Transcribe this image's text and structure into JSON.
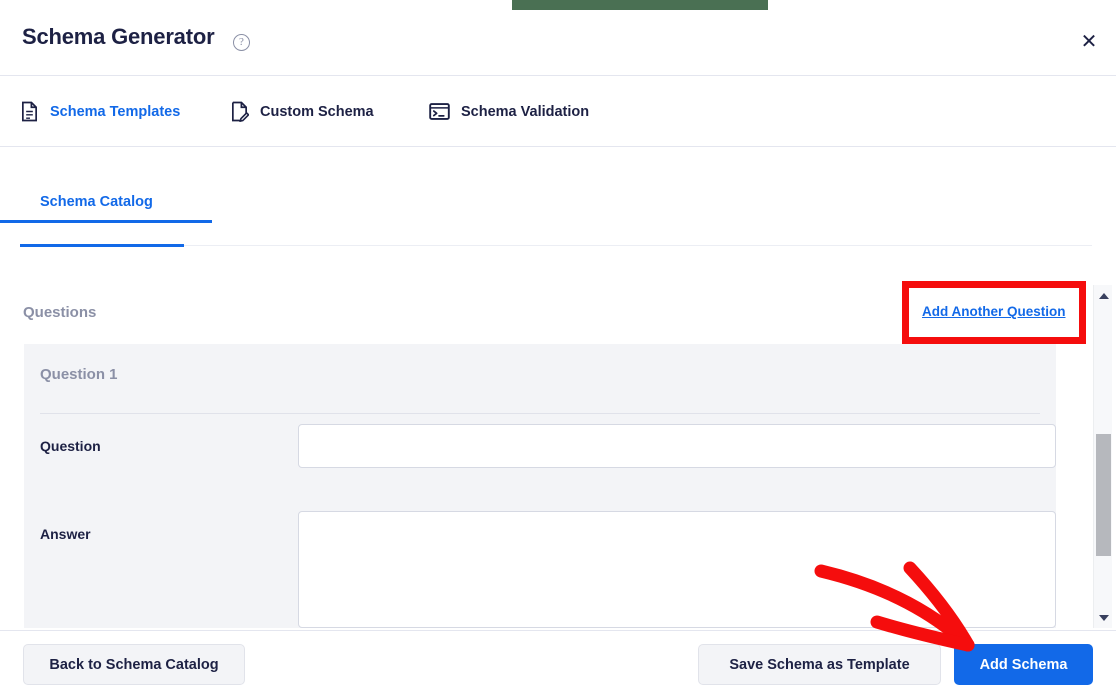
{
  "window": {
    "title": "Schema Generator",
    "help_icon": "question-circle-icon",
    "close_icon": "✕",
    "accent_color": "#1269e8",
    "annotation_color": "#f50d0d",
    "green_strip_color": "#4a7053"
  },
  "tabs": [
    {
      "label": "Schema Templates",
      "icon": "document-lines-icon",
      "active": true
    },
    {
      "label": "Custom Schema",
      "icon": "document-pencil-icon",
      "active": false
    },
    {
      "label": "Schema Validation",
      "icon": "terminal-icon",
      "active": false
    }
  ],
  "subtabs": [
    {
      "label": "Schema Catalog",
      "active": true
    }
  ],
  "content": {
    "section_label": "Questions",
    "add_link": "Add Another Question",
    "question_card": {
      "title": "Question 1",
      "fields": [
        {
          "label": "Question",
          "value": "",
          "placeholder": "",
          "type": "input"
        },
        {
          "label": "Answer",
          "value": "",
          "placeholder": "",
          "type": "textarea"
        }
      ]
    }
  },
  "scrollbar": {
    "up_icon": "chevron-up-icon",
    "down_icon": "chevron-down-icon"
  },
  "footer": {
    "back_label": "Back to Schema Catalog",
    "save_label": "Save Schema as Template",
    "add_label": "Add Schema"
  },
  "annotations": {
    "highlight_target": "Add Another Question",
    "arrow_target": "Add Schema"
  }
}
